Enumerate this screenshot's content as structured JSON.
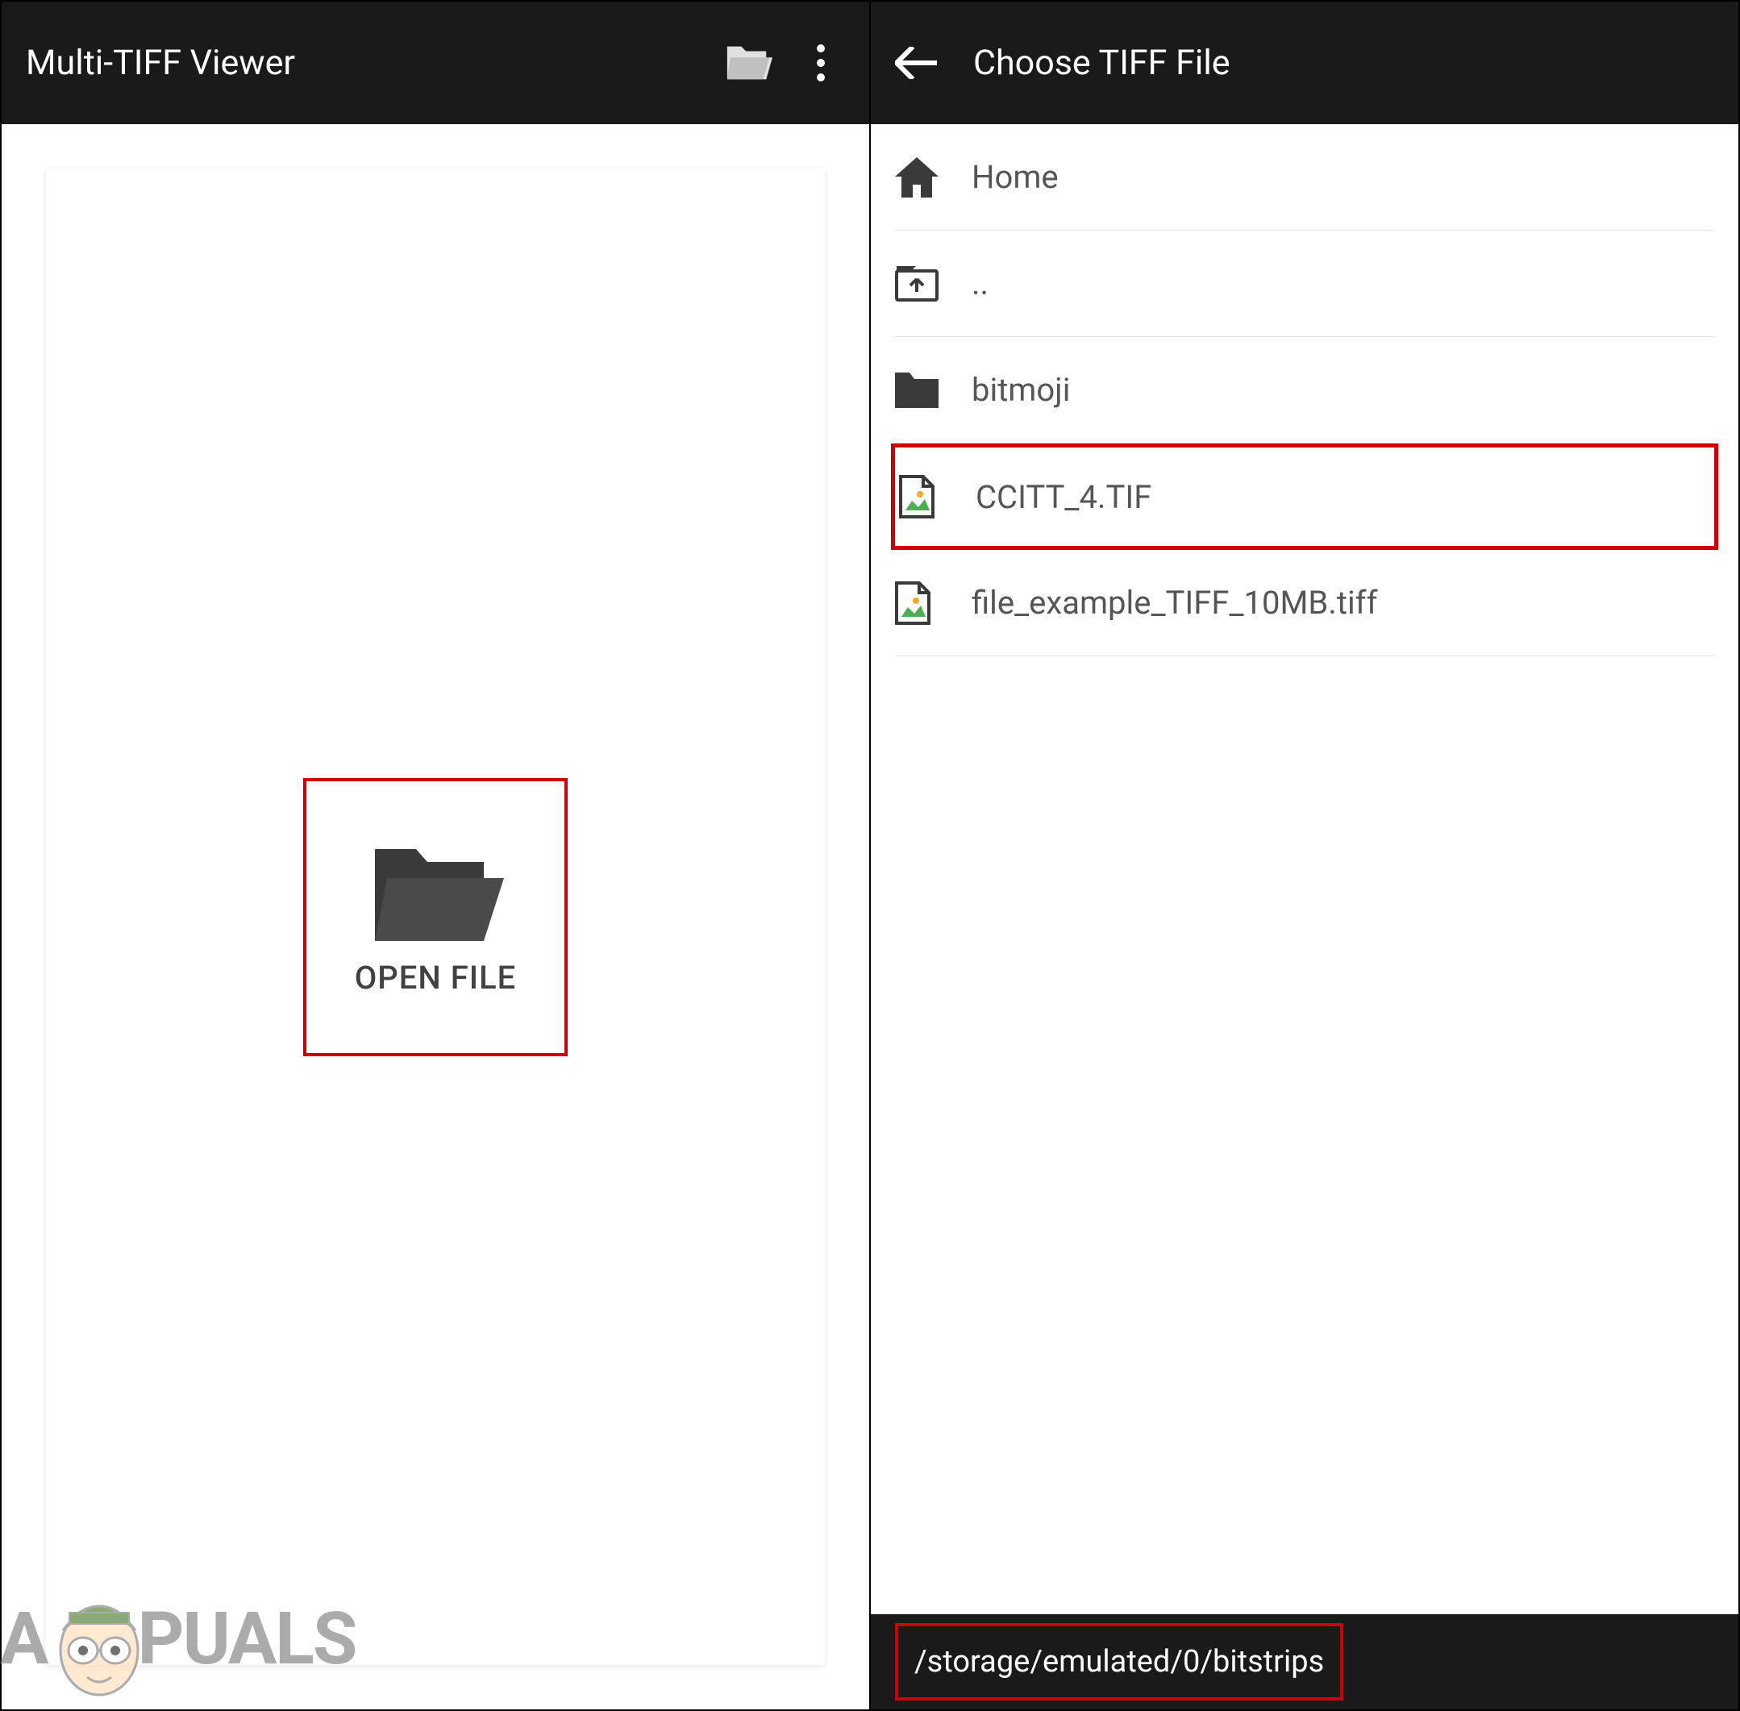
{
  "left_panel": {
    "title": "Multi-TIFF Viewer",
    "open_file_label": "OPEN FILE"
  },
  "right_panel": {
    "title": "Choose TIFF File",
    "items": [
      {
        "label": "Home",
        "icon": "home",
        "highlighted": false
      },
      {
        "label": "..",
        "icon": "folder-up",
        "highlighted": false
      },
      {
        "label": "bitmoji",
        "icon": "folder",
        "highlighted": false
      },
      {
        "label": "CCITT_4.TIF",
        "icon": "image-file",
        "highlighted": true
      },
      {
        "label": "file_example_TIFF_10MB.tiff",
        "icon": "image-file",
        "highlighted": false
      }
    ],
    "current_path": "/storage/emulated/0/bitstrips"
  },
  "watermark": {
    "text_before": "A",
    "text_after": "PUALS"
  }
}
